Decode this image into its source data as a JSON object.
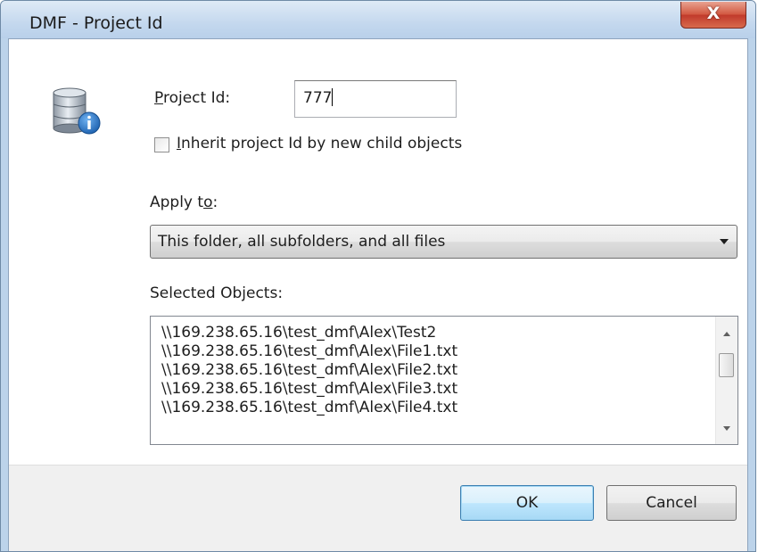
{
  "window": {
    "title": "DMF - Project Id",
    "close_label": "X"
  },
  "icons": {
    "dialog_icon": "database-info-icon",
    "dropdown": "chevron-down-icon",
    "scroll_up": "scroll-up-arrow-icon",
    "scroll_down": "scroll-down-arrow-icon"
  },
  "form": {
    "project_id_label_mnemonic": "P",
    "project_id_label_rest": "roject Id:",
    "project_id_value": "777",
    "inherit_checked": false,
    "inherit_label_mnemonic": "I",
    "inherit_label_rest": "nherit project Id by new child objects",
    "apply_to_label_start": "Apply t",
    "apply_to_label_mnemonic": "o",
    "apply_to_label_end": ":",
    "apply_to_selected": "This folder, all subfolders, and all files",
    "selected_objects_label": "Selected Objects:",
    "selected_objects": [
      "\\\\169.238.65.16\\test_dmf\\Alex\\Test2",
      "\\\\169.238.65.16\\test_dmf\\Alex\\File1.txt",
      "\\\\169.238.65.16\\test_dmf\\Alex\\File2.txt",
      "\\\\169.238.65.16\\test_dmf\\Alex\\File3.txt",
      "\\\\169.238.65.16\\test_dmf\\Alex\\File4.txt"
    ]
  },
  "buttons": {
    "ok": "OK",
    "cancel": "Cancel"
  },
  "colors": {
    "accent_button_border": "#3c7fb1",
    "close_button": "#c0392b",
    "title_bar": "#c4d8ee"
  }
}
